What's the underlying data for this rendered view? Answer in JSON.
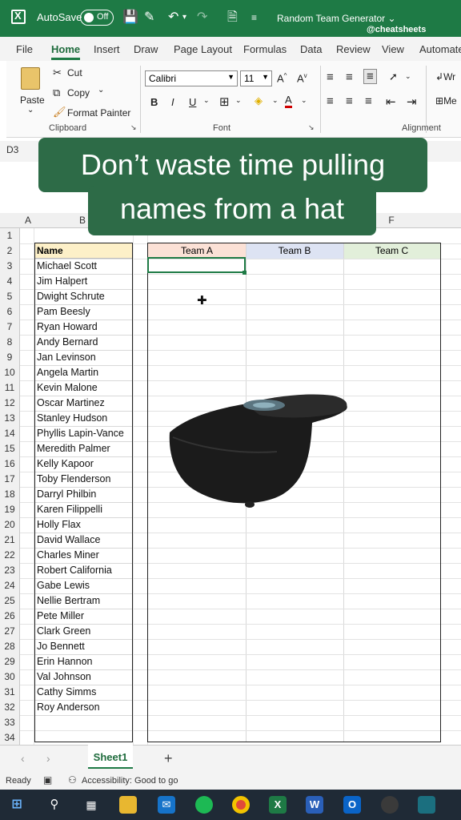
{
  "titlebar": {
    "autosave_label": "AutoSave",
    "autosave_state": "Off",
    "doc_title": "Random Team Generator ⌄",
    "handle": "@cheatsheets"
  },
  "tabs": [
    "File",
    "Home",
    "Insert",
    "Draw",
    "Page Layout",
    "Formulas",
    "Data",
    "Review",
    "View",
    "Automate"
  ],
  "ribbon": {
    "clipboard": {
      "paste": "Paste",
      "cut": "Cut",
      "copy": "Copy",
      "format_painter": "Format Painter",
      "label": "Clipboard"
    },
    "font": {
      "font_name": "Calibri",
      "font_size": "11",
      "label": "Font"
    },
    "alignment": {
      "wrap": "Wr",
      "merge": "Me",
      "label": "Alignment"
    }
  },
  "namebox": "D3",
  "caption": {
    "line1": "Don’t waste time pulling",
    "line2": "names from a hat"
  },
  "columns": [
    "A",
    "B",
    "F"
  ],
  "row_numbers": [
    "1",
    "2",
    "3",
    "4",
    "5",
    "6",
    "7",
    "8",
    "9",
    "10",
    "11",
    "12",
    "13",
    "14",
    "15",
    "16",
    "17",
    "18",
    "19",
    "20",
    "21",
    "22",
    "23",
    "24",
    "25",
    "26",
    "27",
    "28",
    "29",
    "30",
    "31",
    "32",
    "33",
    "34"
  ],
  "names_table": {
    "header": "Name",
    "names": [
      "Michael Scott",
      "Jim Halpert",
      "Dwight Schrute",
      "Pam Beesly",
      "Ryan Howard",
      "Andy Bernard",
      "Jan Levinson",
      "Angela Martin",
      "Kevin Malone",
      "Oscar Martinez",
      "Stanley Hudson",
      "Phyllis Lapin-Vance",
      "Meredith Palmer",
      "Kelly Kapoor",
      "Toby Flenderson",
      "Darryl Philbin",
      "Karen Filippelli",
      "Holly Flax",
      "David Wallace",
      "Charles Miner",
      "Robert California",
      "Gabe Lewis",
      "Nellie Bertram",
      "Pete Miller",
      "Clark Green",
      "Jo Bennett",
      "Erin Hannon",
      "Val Johnson",
      "Cathy Simms",
      "Roy Anderson"
    ]
  },
  "teams_table": {
    "headers": [
      "Team A",
      "Team B",
      "Team C"
    ],
    "header_colors": [
      "#fbe1d6",
      "#dde3f3",
      "#e2efda"
    ]
  },
  "sheetbar": {
    "sheet_name": "Sheet1",
    "add": "+"
  },
  "statusbar": {
    "ready": "Ready",
    "accessibility": "Accessibility: Good to go"
  },
  "taskbar": [
    "windows-icon",
    "search-icon",
    "task-view-icon",
    "file-explorer-icon",
    "mail-icon",
    "spotify-icon",
    "chrome-icon",
    "excel-icon",
    "word-icon",
    "outlook-icon",
    "obs-icon",
    "app-icon"
  ]
}
